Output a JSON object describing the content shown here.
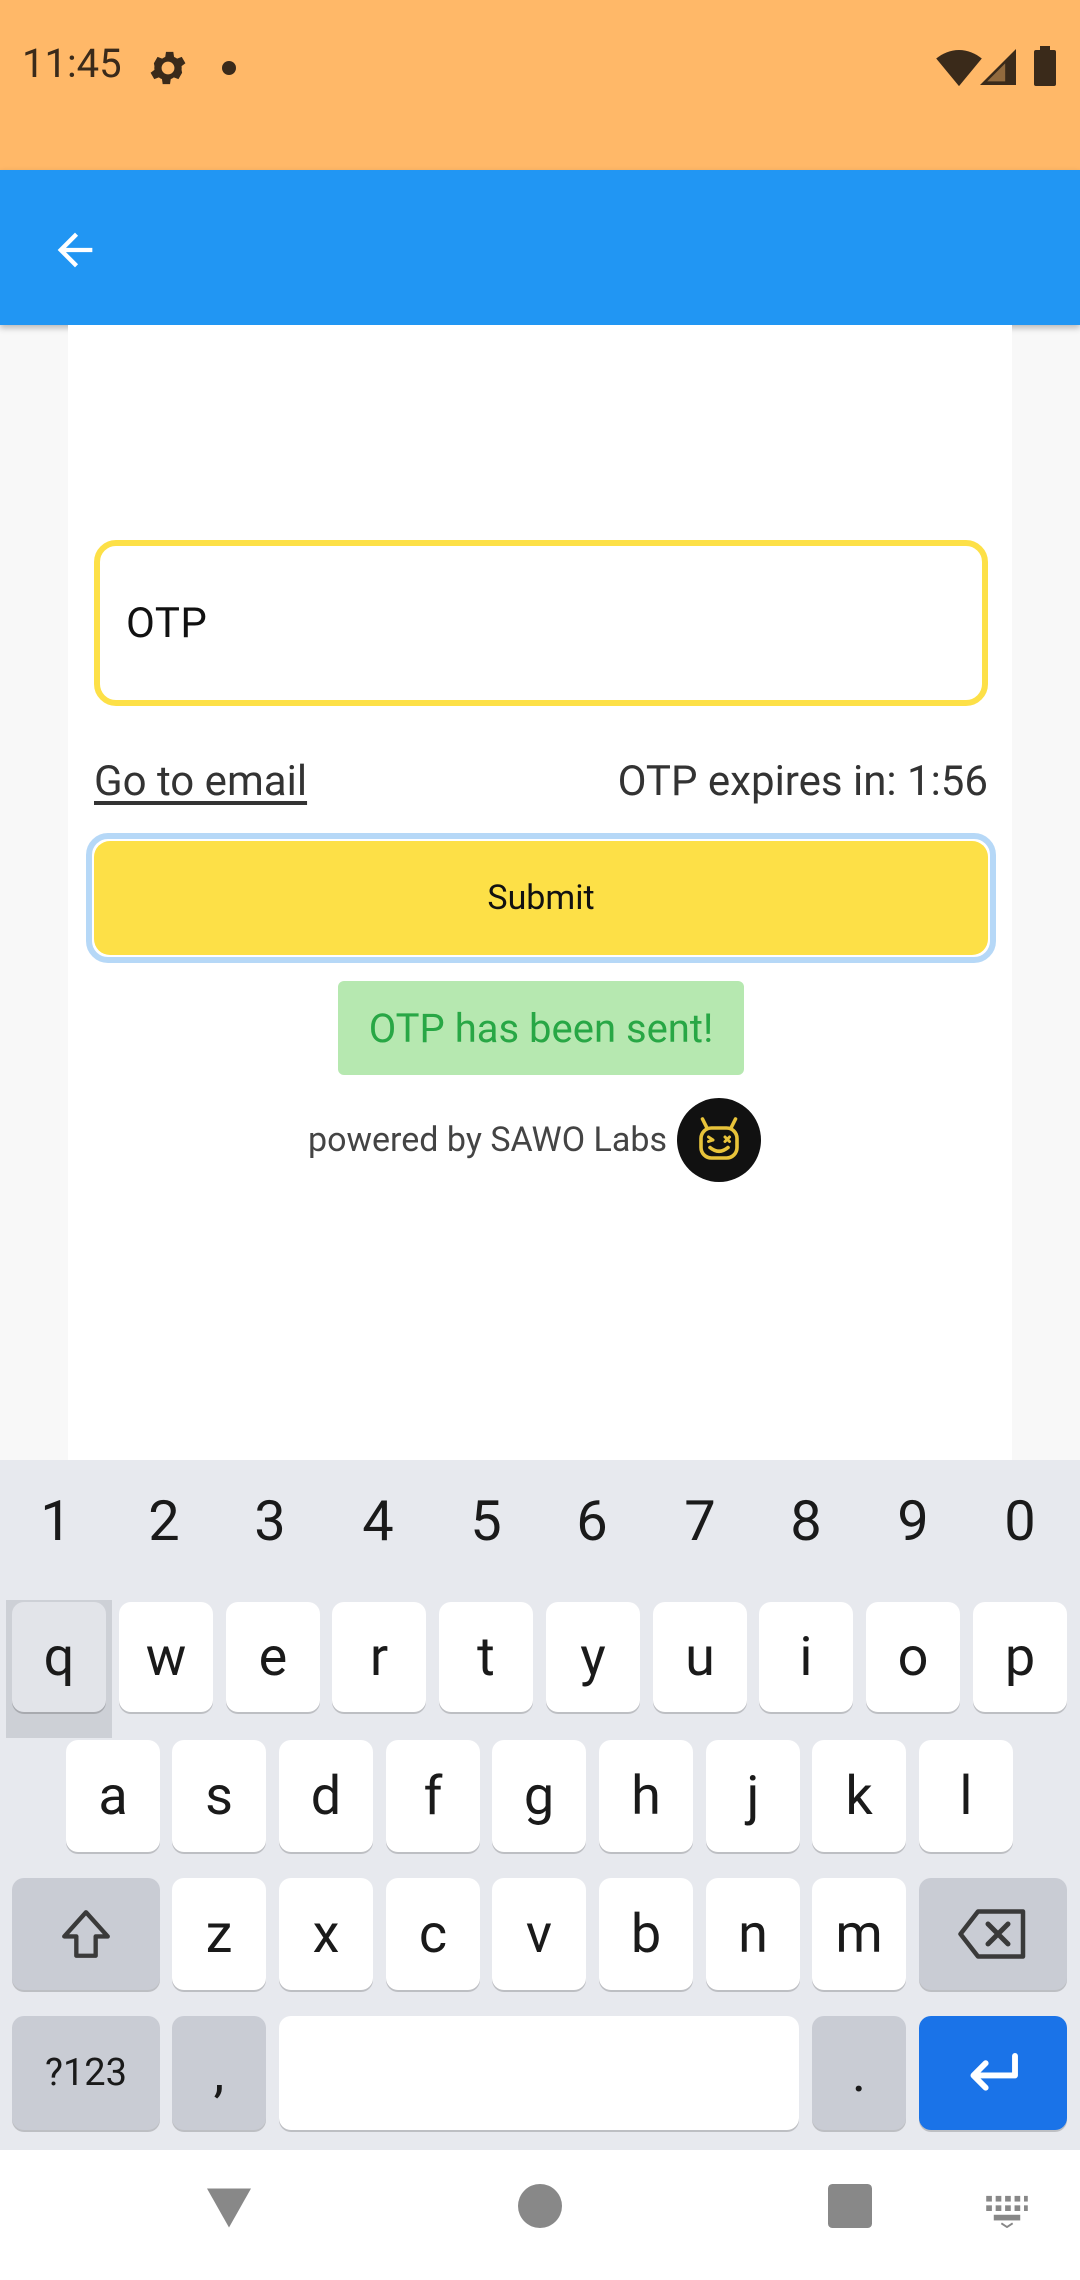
{
  "status_bar": {
    "time": "11:45",
    "icons": [
      "settings-icon",
      "notification-dot-icon",
      "wifi-icon",
      "signal-icon",
      "battery-icon"
    ]
  },
  "app_bar": {
    "back_icon": "arrow-back-icon",
    "color": "#2196f3"
  },
  "form": {
    "otp_value": "OTP",
    "go_to_email_label": "Go to email",
    "otp_expiry_text": "OTP expires in: 1:56",
    "submit_label": "Submit",
    "toast_text": "OTP has been sent!",
    "powered_by_text": "powered by SAWO Labs",
    "accent_color": "#fde047"
  },
  "keyboard": {
    "number_row": [
      "1",
      "2",
      "3",
      "4",
      "5",
      "6",
      "7",
      "8",
      "9",
      "0"
    ],
    "row1": [
      "q",
      "w",
      "e",
      "r",
      "t",
      "y",
      "u",
      "i",
      "o",
      "p"
    ],
    "row2": [
      "a",
      "s",
      "d",
      "f",
      "g",
      "h",
      "j",
      "k",
      "l"
    ],
    "row3": [
      "z",
      "x",
      "c",
      "v",
      "b",
      "n",
      "m"
    ],
    "symbols_label": "?123",
    "comma_label": ",",
    "period_label": ".",
    "enter_color": "#1a73e8"
  },
  "nav_bar": {
    "icons": [
      "back-triangle-icon",
      "home-circle-icon",
      "recents-square-icon",
      "keyboard-icon"
    ]
  }
}
